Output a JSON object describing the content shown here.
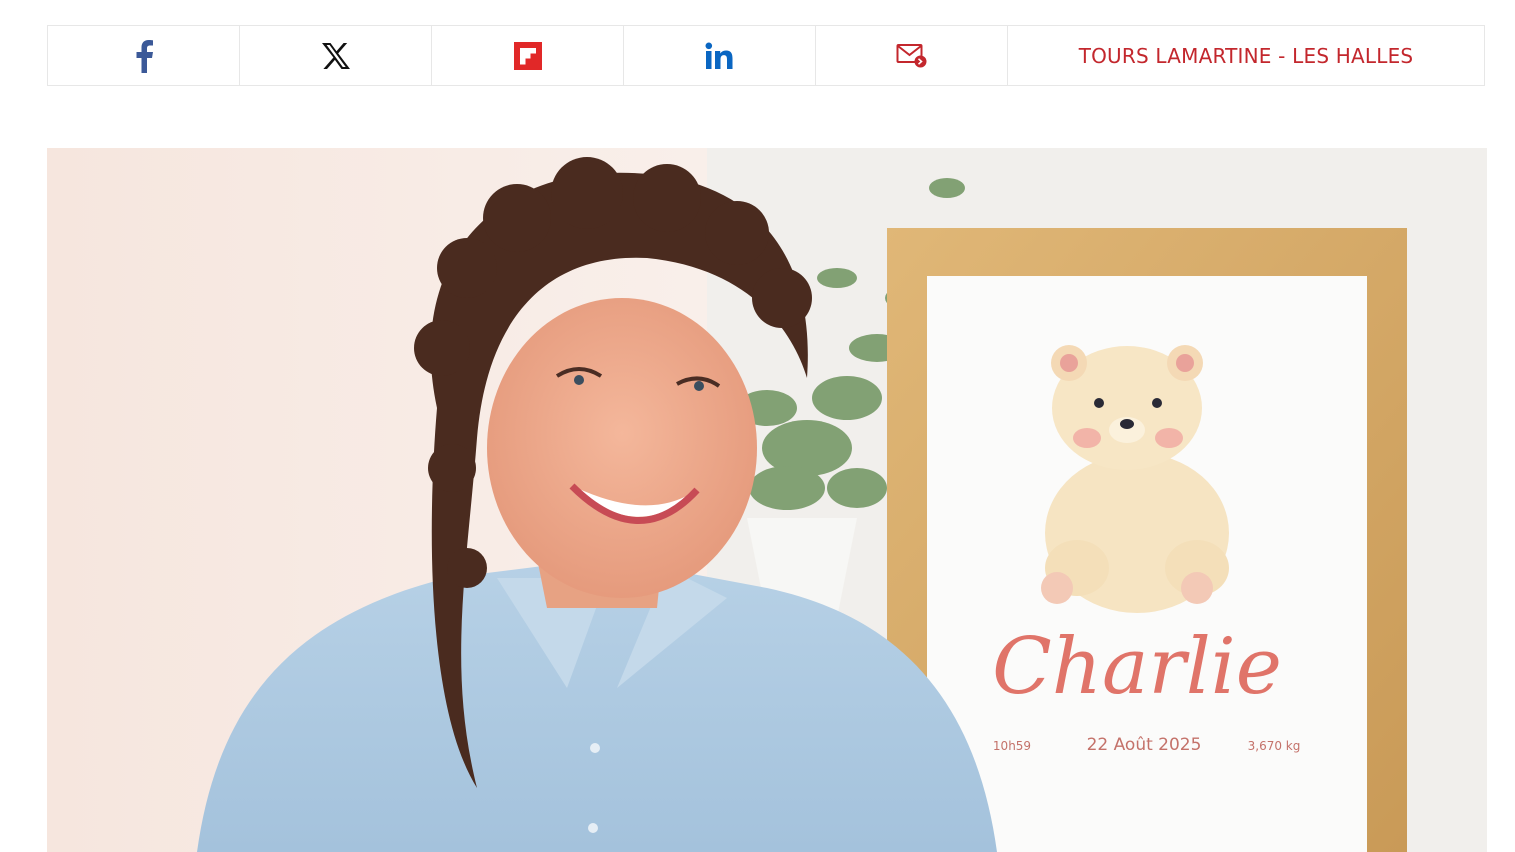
{
  "share": {
    "buttons": [
      {
        "icon": "facebook-icon",
        "color": "#3b5998"
      },
      {
        "icon": "x-icon",
        "color": "#000000"
      },
      {
        "icon": "flipboard-icon",
        "color": "#e12828"
      },
      {
        "icon": "linkedin-icon",
        "color": "#0a66c2"
      },
      {
        "icon": "email-icon",
        "color": "#c3272d"
      }
    ],
    "tag": "TOURS LAMARTINE - LES HALLES"
  },
  "hero": {
    "frame_name": "Charlie",
    "frame_time": "10h59",
    "frame_date": "22 Août 2025",
    "frame_weight": "3,670 kg"
  },
  "colors": {
    "accent": "#c3272d",
    "border": "#e7e7e7"
  }
}
